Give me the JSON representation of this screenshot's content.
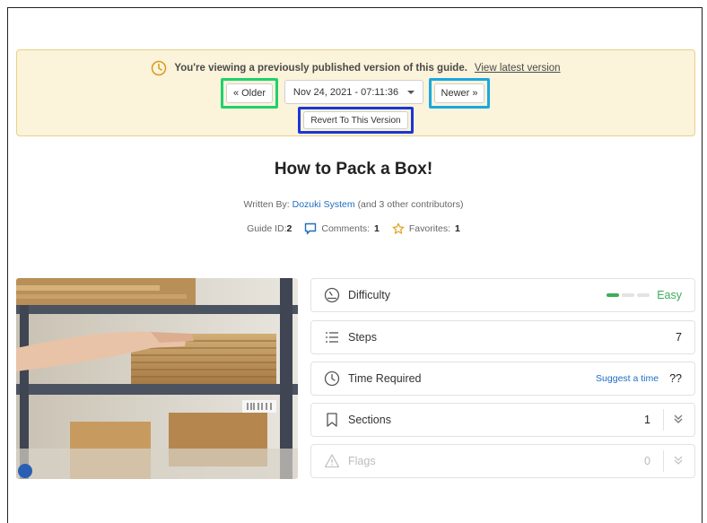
{
  "banner": {
    "message": "You're viewing a previously published version of this guide.",
    "link": "View latest version",
    "older_label": "« Older",
    "version_select": "Nov 24, 2021 - 07:11:36",
    "newer_label": "Newer »",
    "revert_label": "Revert To This Version"
  },
  "guide": {
    "title": "How to Pack a Box!",
    "written_by_prefix": "Written By:",
    "author": "Dozuki System",
    "contributors": "(and 3 other contributors)",
    "guide_id_label": "Guide ID:",
    "guide_id": "2",
    "comments_label": "Comments:",
    "comments": "1",
    "favorites_label": "Favorites:",
    "favorites": "1"
  },
  "stats": {
    "difficulty_label": "Difficulty",
    "difficulty_value": "Easy",
    "difficulty_level": 1,
    "difficulty_max": 3,
    "steps_label": "Steps",
    "steps_value": "7",
    "time_label": "Time Required",
    "time_suggest": "Suggest a time",
    "time_value": "??",
    "sections_label": "Sections",
    "sections_value": "1",
    "flags_label": "Flags",
    "flags_value": "0"
  },
  "colors": {
    "banner_bg": "#fbf3da",
    "link": "#1f6fc1",
    "easy": "#3dae5b",
    "highlight_older": "#1fd16c",
    "highlight_newer": "#1aa8e0",
    "highlight_revert": "#1b36d6"
  }
}
